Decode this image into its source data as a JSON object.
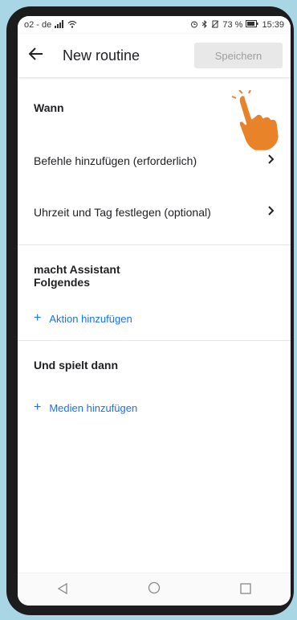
{
  "status": {
    "carrier": "o2 - de",
    "signal": "signal-icon",
    "wifi": "wifi-icon",
    "right_text": "73 %",
    "time": "15:39"
  },
  "appbar": {
    "title": "New routine",
    "save_label": "Speichern"
  },
  "sections": {
    "wann": {
      "title": "Wann",
      "items": [
        "Befehle hinzufügen (erforderlich)",
        "Uhrzeit und Tag festlegen (optional)"
      ]
    },
    "assistant": {
      "title_line1": "macht Assistant",
      "title_line2": "Folgendes",
      "action": "Aktion hinzufügen"
    },
    "media": {
      "title": "Und spielt dann",
      "action": "Medien hinzufügen"
    }
  },
  "navbar": {
    "back": "back-nav-icon",
    "home": "home-nav-icon",
    "recents": "recents-nav-icon"
  },
  "colors": {
    "accent": "#1a73e8",
    "hand": "#e8832a",
    "background": "#a9d6e4"
  }
}
